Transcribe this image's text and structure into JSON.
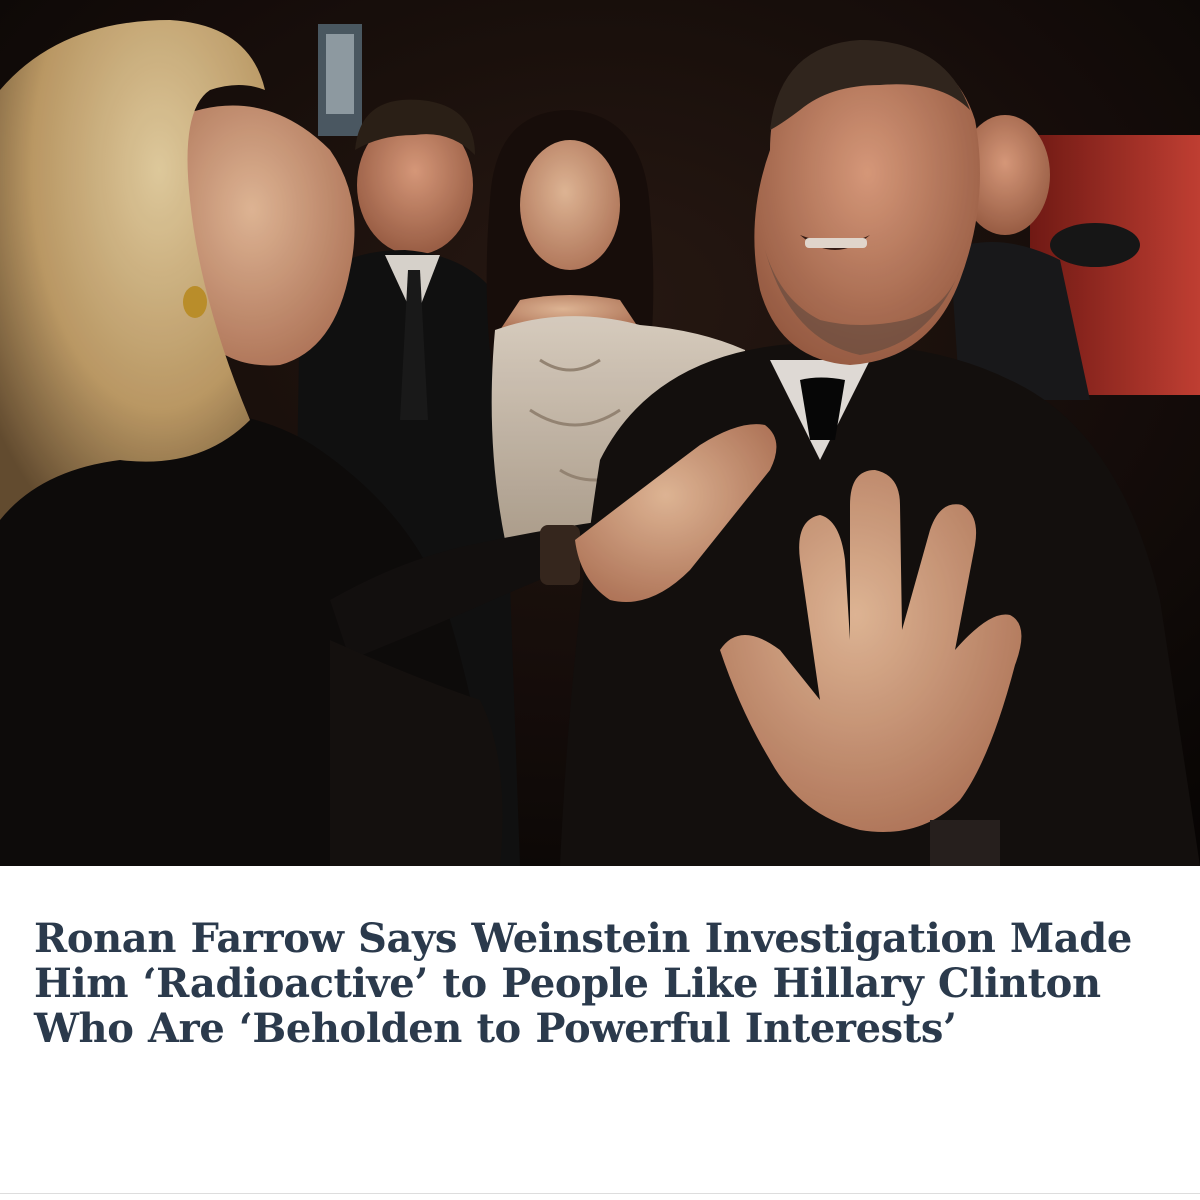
{
  "article": {
    "headline": "Ronan Farrow Says Weinstein Investigation Made Him ‘Radioactive’ to People Like Hillary Clinton Who Are ‘Beholden to Powerful Interests’",
    "photo": {
      "icon": "news-photo",
      "subject": "event-photo"
    }
  },
  "theme": {
    "headline_color": "#2b3a4c",
    "background": "#ffffff",
    "photo_backdrop": "#0d0807",
    "accent_red": "#c4362c"
  }
}
